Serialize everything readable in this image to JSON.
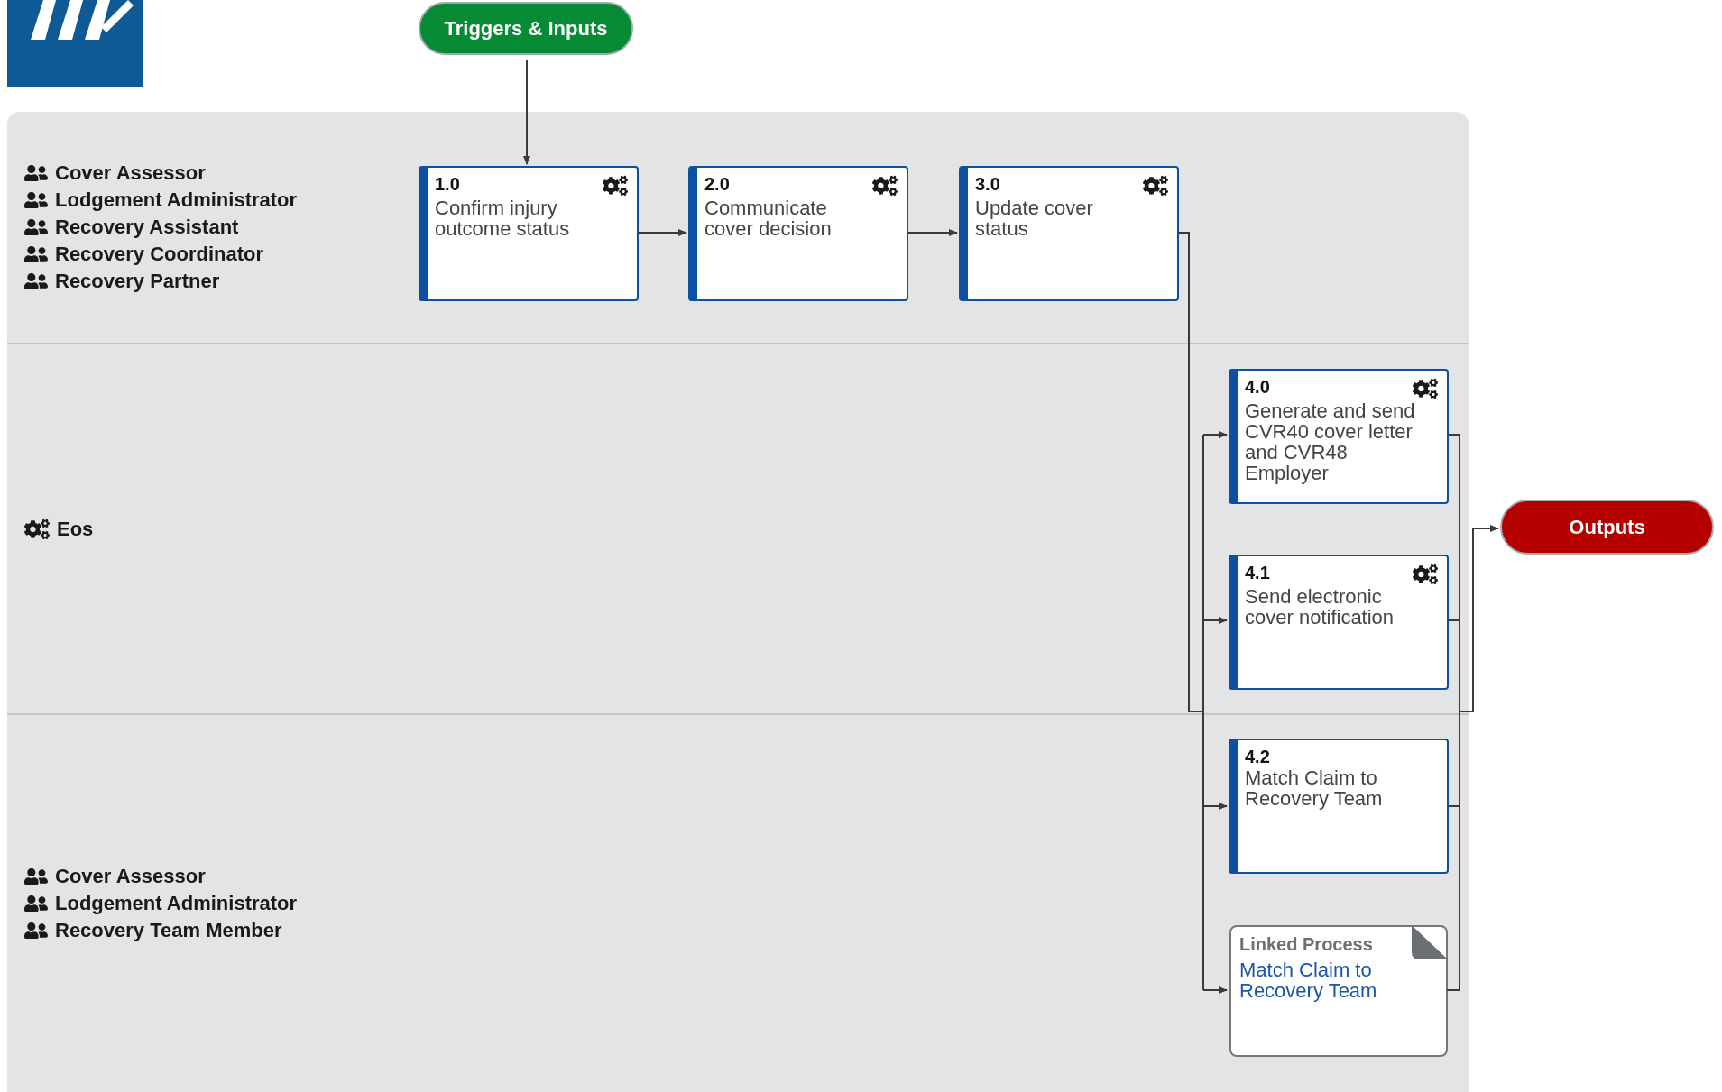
{
  "trigger": "Triggers & Inputs",
  "output": "Outputs",
  "lanes": [
    {
      "roles": [
        {
          "name": "Cover Assessor",
          "kind": "person"
        },
        {
          "name": "Lodgement Administrator",
          "kind": "person"
        },
        {
          "name": "Recovery Assistant",
          "kind": "person"
        },
        {
          "name": "Recovery Coordinator",
          "kind": "person"
        },
        {
          "name": "Recovery Partner",
          "kind": "person"
        }
      ]
    },
    {
      "roles": [
        {
          "name": "Eos",
          "kind": "system"
        }
      ]
    },
    {
      "roles": [
        {
          "name": "Cover Assessor",
          "kind": "person"
        },
        {
          "name": "Lodgement Administrator",
          "kind": "person"
        },
        {
          "name": "Recovery Team Member",
          "kind": "person"
        }
      ]
    }
  ],
  "tasks": [
    {
      "number": "1.0",
      "title": "Confirm injury outcome status",
      "automated": true
    },
    {
      "number": "2.0",
      "title": "Communicate cover decision",
      "automated": true
    },
    {
      "number": "3.0",
      "title": "Update cover status",
      "automated": true
    },
    {
      "number": "4.0",
      "title": "Generate and send CVR40 cover letter and CVR48 Employer",
      "automated": true
    },
    {
      "number": "4.1",
      "title": "Send electronic cover notification",
      "automated": true
    },
    {
      "number": "4.2",
      "title": "Match Claim to Recovery Team",
      "automated": false
    }
  ],
  "linked_process": {
    "label": "Linked Process",
    "title": "Match Claim to Recovery Team"
  }
}
